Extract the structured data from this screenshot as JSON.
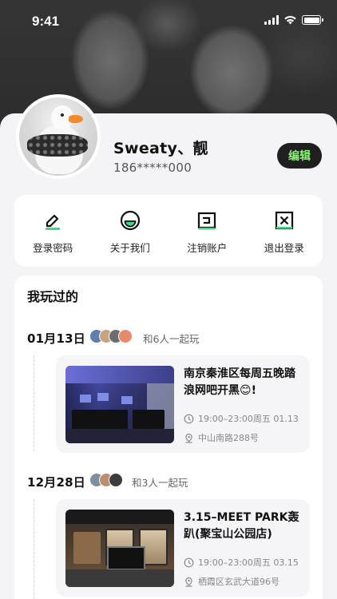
{
  "status_bar": {
    "time": "9:41"
  },
  "profile": {
    "username": "Sweaty、靓",
    "phone": "186*****000",
    "edit_label": "编辑"
  },
  "menu": [
    {
      "label": "登录密码",
      "icon": "pencil-icon"
    },
    {
      "label": "关于我们",
      "icon": "smile-circle-icon"
    },
    {
      "label": "注销账户",
      "icon": "logout-box-icon"
    },
    {
      "label": "退出登录",
      "icon": "close-box-icon"
    }
  ],
  "played": {
    "title": "我玩过的",
    "groups": [
      {
        "date": "01月13日",
        "with_text": "和6人一起玩",
        "event": {
          "title": "南京秦淮区每周五晚踏浪网吧开黑😊!",
          "time": "19:00–23:00周五 01.13",
          "location": "中山南路288号"
        }
      },
      {
        "date": "12月28日",
        "with_text": "和3人一起玩",
        "event": {
          "title": " 3.15–MEET PARK轰趴(聚宝山公园店)",
          "time": "19:00–23:00周五 03.15",
          "location": "栖霞区玄武大道96号"
        }
      }
    ]
  },
  "colors": {
    "accent_green": "#7cf0a0",
    "edit_text": "#8ef07a",
    "dark": "#1f1f1f"
  }
}
